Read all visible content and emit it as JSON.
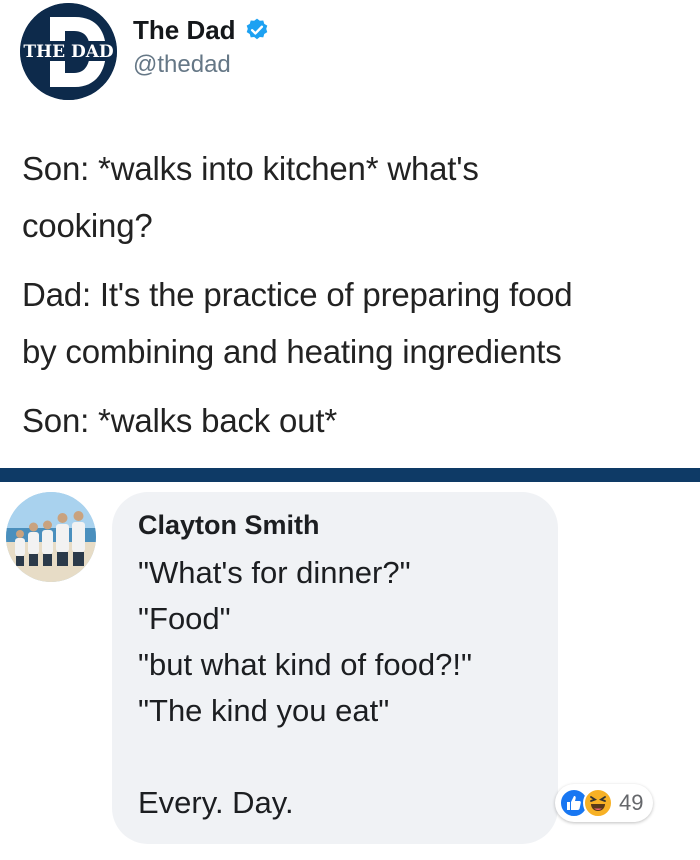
{
  "tweet": {
    "display_name": "The Dad",
    "handle": "@thedad",
    "logo_text": "THE DAD",
    "logo_letter": "D",
    "verified_icon": "verified-badge-icon",
    "lines": [
      "Son: *walks into kitchen* what's",
      "cooking?",
      "Dad: It's the practice of preparing food",
      "by combining and heating ingredients",
      "Son: *walks back out*"
    ]
  },
  "comment": {
    "author": "Clayton Smith",
    "lines": [
      "\"What's for dinner?\"",
      "\"Food\"",
      "\"but what kind of food?!\"",
      "\"The kind you eat\"",
      "",
      "Every. Day."
    ],
    "reactions": {
      "icons": [
        "like-icon",
        "haha-icon"
      ],
      "count": "49"
    }
  },
  "colors": {
    "divider": "#0e3a66",
    "verified": "#1da1f2",
    "bubble": "#f0f2f5",
    "like": "#1877f2",
    "haha": "#f7b125"
  }
}
